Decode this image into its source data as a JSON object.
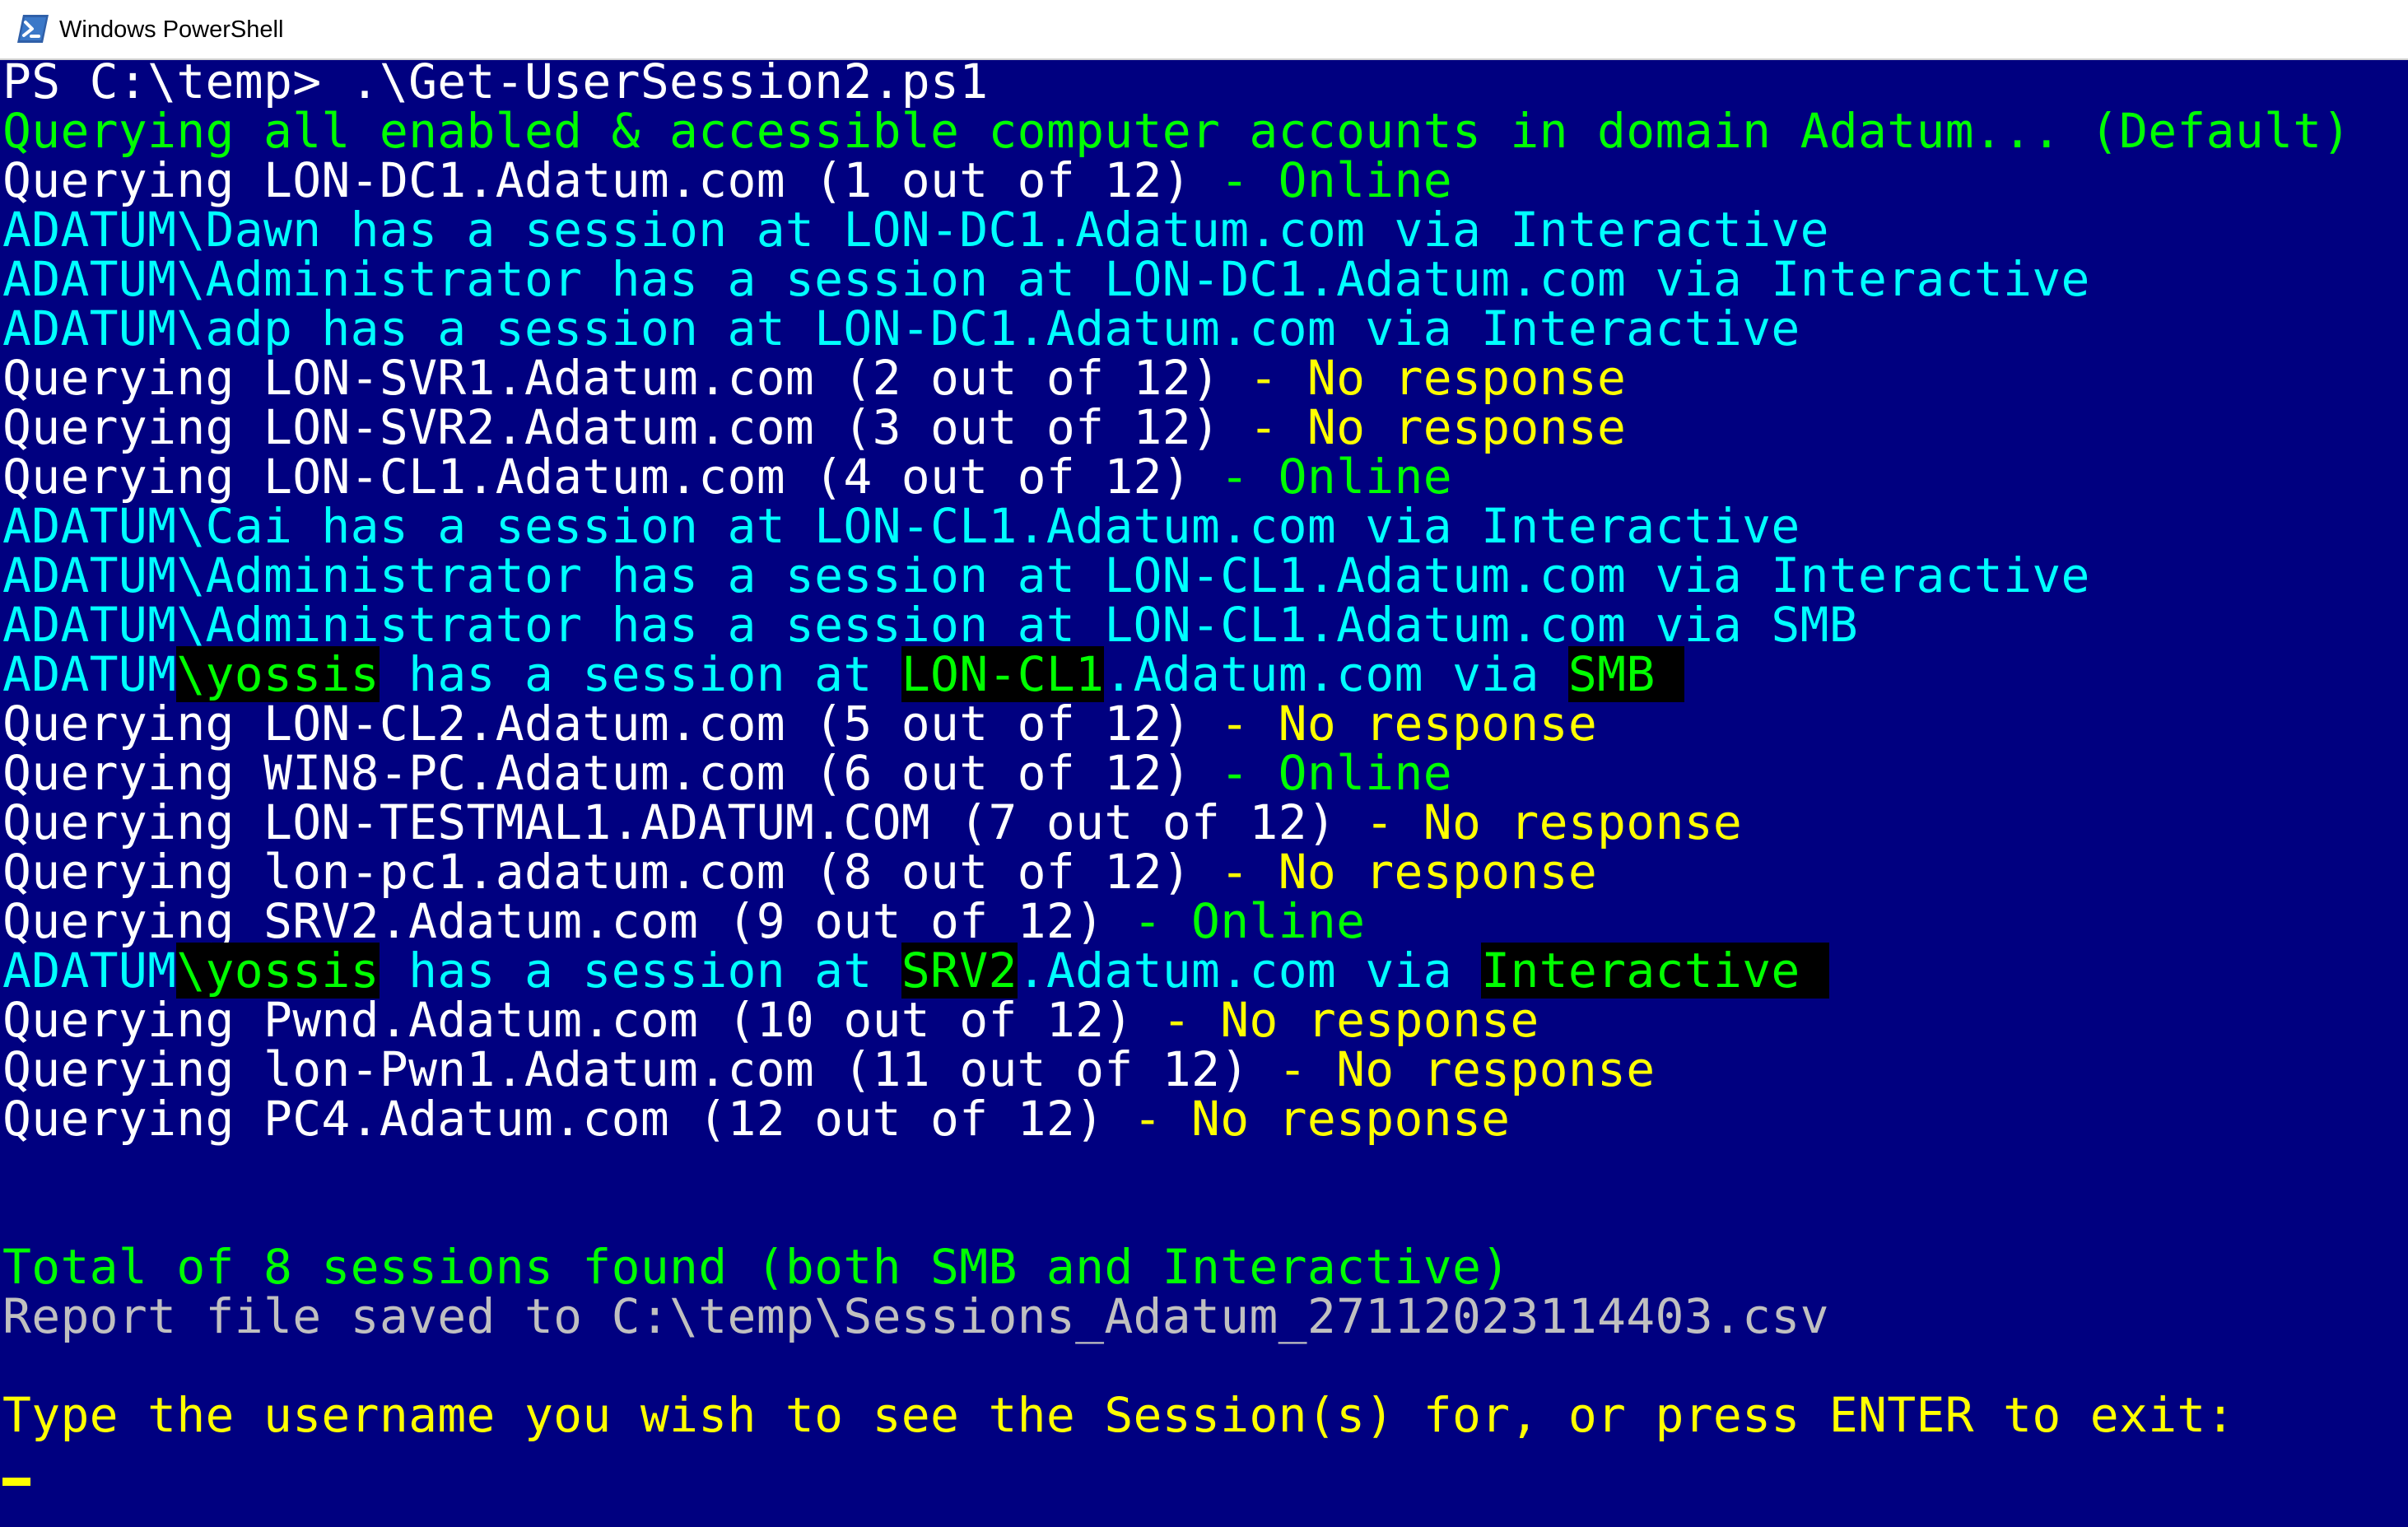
{
  "window": {
    "title": "Windows PowerShell",
    "icon": "powershell-icon"
  },
  "console": {
    "lines": [
      {
        "type": "cmd",
        "prompt": "PS C:\\temp>",
        "text": " .\\Get-UserSession2.ps1"
      },
      {
        "type": "info",
        "text": "Querying all enabled & accessible computer accounts in domain Adatum... (Default)"
      },
      {
        "type": "query",
        "prefix": "Querying LON-DC1.Adatum.com (1 out of 12)",
        "status": " - Online",
        "status_color": "#00ff00"
      },
      {
        "type": "session",
        "text": "ADATUM\\Dawn has a session at LON-DC1.Adatum.com via Interactive"
      },
      {
        "type": "session",
        "text": "ADATUM\\Administrator has a session at LON-DC1.Adatum.com via Interactive"
      },
      {
        "type": "session",
        "text": "ADATUM\\adp has a session at LON-DC1.Adatum.com via Interactive"
      },
      {
        "type": "query",
        "prefix": "Querying LON-SVR1.Adatum.com (2 out of 12)",
        "status": " - No response",
        "status_color": "#ffff00"
      },
      {
        "type": "query",
        "prefix": "Querying LON-SVR2.Adatum.com (3 out of 12)",
        "status": " - No response",
        "status_color": "#ffff00"
      },
      {
        "type": "query",
        "prefix": "Querying LON-CL1.Adatum.com (4 out of 12)",
        "status": " - Online",
        "status_color": "#00ff00"
      },
      {
        "type": "session",
        "text": "ADATUM\\Cai has a session at LON-CL1.Adatum.com via Interactive"
      },
      {
        "type": "session",
        "text": "ADATUM\\Administrator has a session at LON-CL1.Adatum.com via Interactive"
      },
      {
        "type": "session",
        "text": "ADATUM\\Administrator has a session at LON-CL1.Adatum.com via SMB"
      },
      {
        "type": "highlight",
        "domain": "ADATUM",
        "user": "\\yossis",
        "mid": " has a session at ",
        "host": "LON-CL1",
        "suffix": ".Adatum.com via ",
        "method": "SMB"
      },
      {
        "type": "query",
        "prefix": "Querying LON-CL2.Adatum.com (5 out of 12)",
        "status": " - No response",
        "status_color": "#ffff00"
      },
      {
        "type": "query",
        "prefix": "Querying WIN8-PC.Adatum.com (6 out of 12)",
        "status": " - Online",
        "status_color": "#00ff00"
      },
      {
        "type": "query",
        "prefix": "Querying LON-TESTMAL1.ADATUM.COM (7 out of 12)",
        "status": " - No response",
        "status_color": "#ffff00"
      },
      {
        "type": "query",
        "prefix": "Querying lon-pc1.adatum.com (8 out of 12)",
        "status": " - No response",
        "status_color": "#ffff00"
      },
      {
        "type": "query",
        "prefix": "Querying SRV2.Adatum.com (9 out of 12)",
        "status": " - Online",
        "status_color": "#00ff00"
      },
      {
        "type": "highlight",
        "domain": "ADATUM",
        "user": "\\yossis",
        "mid": " has a session at ",
        "host": "SRV2",
        "suffix": ".Adatum.com via ",
        "method": "Interactive"
      },
      {
        "type": "query",
        "prefix": "Querying Pwnd.Adatum.com (10 out of 12)",
        "status": " - No response",
        "status_color": "#ffff00"
      },
      {
        "type": "query",
        "prefix": "Querying lon-Pwn1.Adatum.com (11 out of 12)",
        "status": " - No response",
        "status_color": "#ffff00"
      },
      {
        "type": "query",
        "prefix": "Querying PC4.Adatum.com (12 out of 12)",
        "status": " - No response",
        "status_color": "#ffff00"
      },
      {
        "type": "blank"
      },
      {
        "type": "blank"
      },
      {
        "type": "info",
        "text": "Total of 8 sessions found (both SMB and Interactive)"
      },
      {
        "type": "report",
        "text": "Report file saved to C:\\temp\\Sessions_Adatum_27112023114403.csv"
      },
      {
        "type": "blank"
      },
      {
        "type": "prompt",
        "text": "Type the username you wish to see the Session(s) for, or press ENTER to exit:"
      },
      {
        "type": "cursor"
      }
    ]
  },
  "colors": {
    "background": "#000080",
    "default_text": "#ffffff",
    "info": "#00ff00",
    "session": "#00ffff",
    "warning": "#ffff00",
    "report": "#c0c0c0",
    "highlight_bg": "#000000"
  }
}
